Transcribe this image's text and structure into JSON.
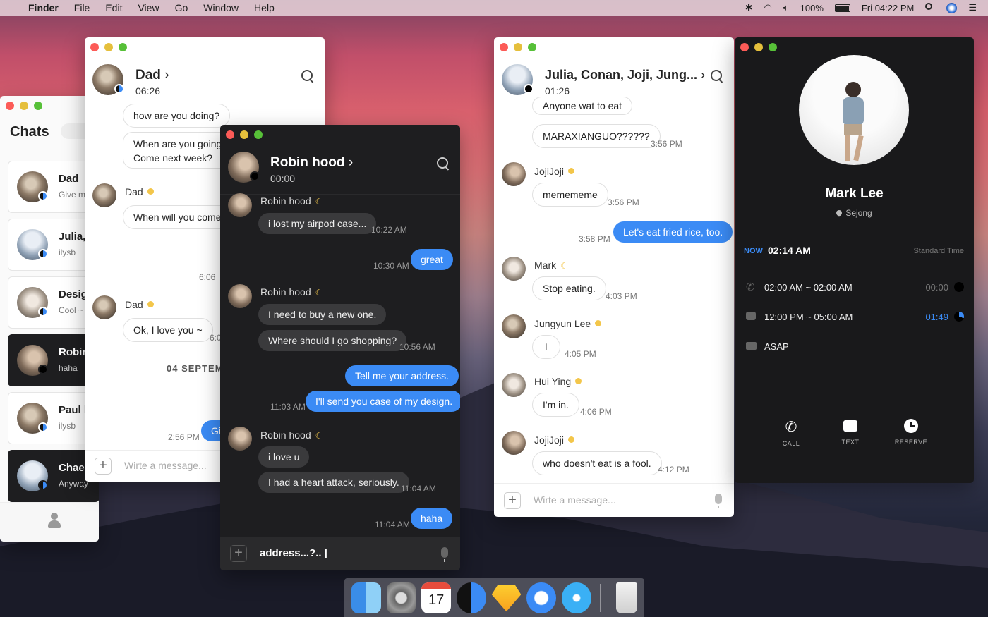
{
  "menubar": {
    "app": "Finder",
    "items": [
      "File",
      "Edit",
      "View",
      "Go",
      "Window",
      "Help"
    ],
    "battery": "100%",
    "clock": "Fri 04:22 PM"
  },
  "chats_window": {
    "title": "Chats",
    "items": [
      {
        "name": "Dad",
        "preview": "Give m"
      },
      {
        "name": "Julia,",
        "preview": "ilysb"
      },
      {
        "name": "Desig",
        "preview": "Cool ~"
      },
      {
        "name": "Robin",
        "preview": "haha"
      },
      {
        "name": "Paul k",
        "preview": "ilysb"
      },
      {
        "name": "Chae",
        "preview": "Anyway"
      }
    ]
  },
  "dad_window": {
    "name": "Dad",
    "timer": "06:26",
    "messages": {
      "m1": "how are you doing?",
      "m2a": "When are you going h",
      "m2b": "Come next week?",
      "sender1": "Dad",
      "m3": "When will you come?",
      "t1": "6:06",
      "sender2": "Dad",
      "m4": "Ok, I love you ~",
      "t2": "6:0",
      "date": "04 SEPTEM",
      "t3": "2:56 PM",
      "mblue": "Gi"
    },
    "input_placeholder": "Wirte a message..."
  },
  "robin_window": {
    "name": "Robin hood",
    "timer": "00:00",
    "messages": {
      "s1": "Robin hood",
      "r1": "i lost my airpod case...",
      "t1": "10:22 AM",
      "b1": "great",
      "t2": "10:30 AM",
      "s2": "Robin hood",
      "r2": "I need to buy a new one.",
      "r3": "Where should I go shopping?",
      "t3": "10:56 AM",
      "b2": "Tell me your address.",
      "b3": "I'll send you case of my design.",
      "t4": "11:03 AM",
      "s3": "Robin hood",
      "r4": "i love u",
      "r5": "I had a heart attack, seriously.",
      "t5": "11:04 AM",
      "b4": "haha",
      "t6": "11:04 AM"
    },
    "input_value": "address...?.. |"
  },
  "group_window": {
    "name": "Julia, Conan, Joji, Jung...",
    "timer": "01:26",
    "messages": {
      "m0": "Anyone wat to eat",
      "m1": "MARAXIANGUO??????",
      "t1": "3:56 PM",
      "s2": "JojiJoji",
      "m2": "memememe",
      "t2": "3:56 PM",
      "b1": "Let's eat fried rice, too.",
      "t3": "3:58 PM",
      "s3": "Mark",
      "m3": "Stop eating.",
      "t4": "4:03 PM",
      "s4": "Jungyun Lee",
      "m4": "⊥",
      "t5": "4:05 PM",
      "s5": "Hui Ying",
      "m5": "I'm in.",
      "t6": "4:06 PM",
      "s6": "JojiJoji",
      "m6": "who doesn't eat is a fool.",
      "t7": "4:12 PM"
    },
    "input_placeholder": "Wirte a message..."
  },
  "profile_window": {
    "name": "Mark Lee",
    "location": "Sejong",
    "now_label": "NOW",
    "now_time": "02:14 AM",
    "zone": "Standard Time",
    "schedule": [
      {
        "range": "02:00 AM ~ 02:00 AM",
        "value": "00:00",
        "icon": "call-off-icon"
      },
      {
        "range": "12:00 PM ~ 05:00 AM",
        "value": "01:49",
        "icon": "chat-icon",
        "highlight": "#3b8bf5"
      },
      {
        "range": "ASAP",
        "value": "",
        "icon": "mail-icon"
      }
    ],
    "actions": [
      "CALL",
      "TEXT",
      "RESERVE"
    ]
  },
  "dock": {
    "calendar_day": "17"
  }
}
